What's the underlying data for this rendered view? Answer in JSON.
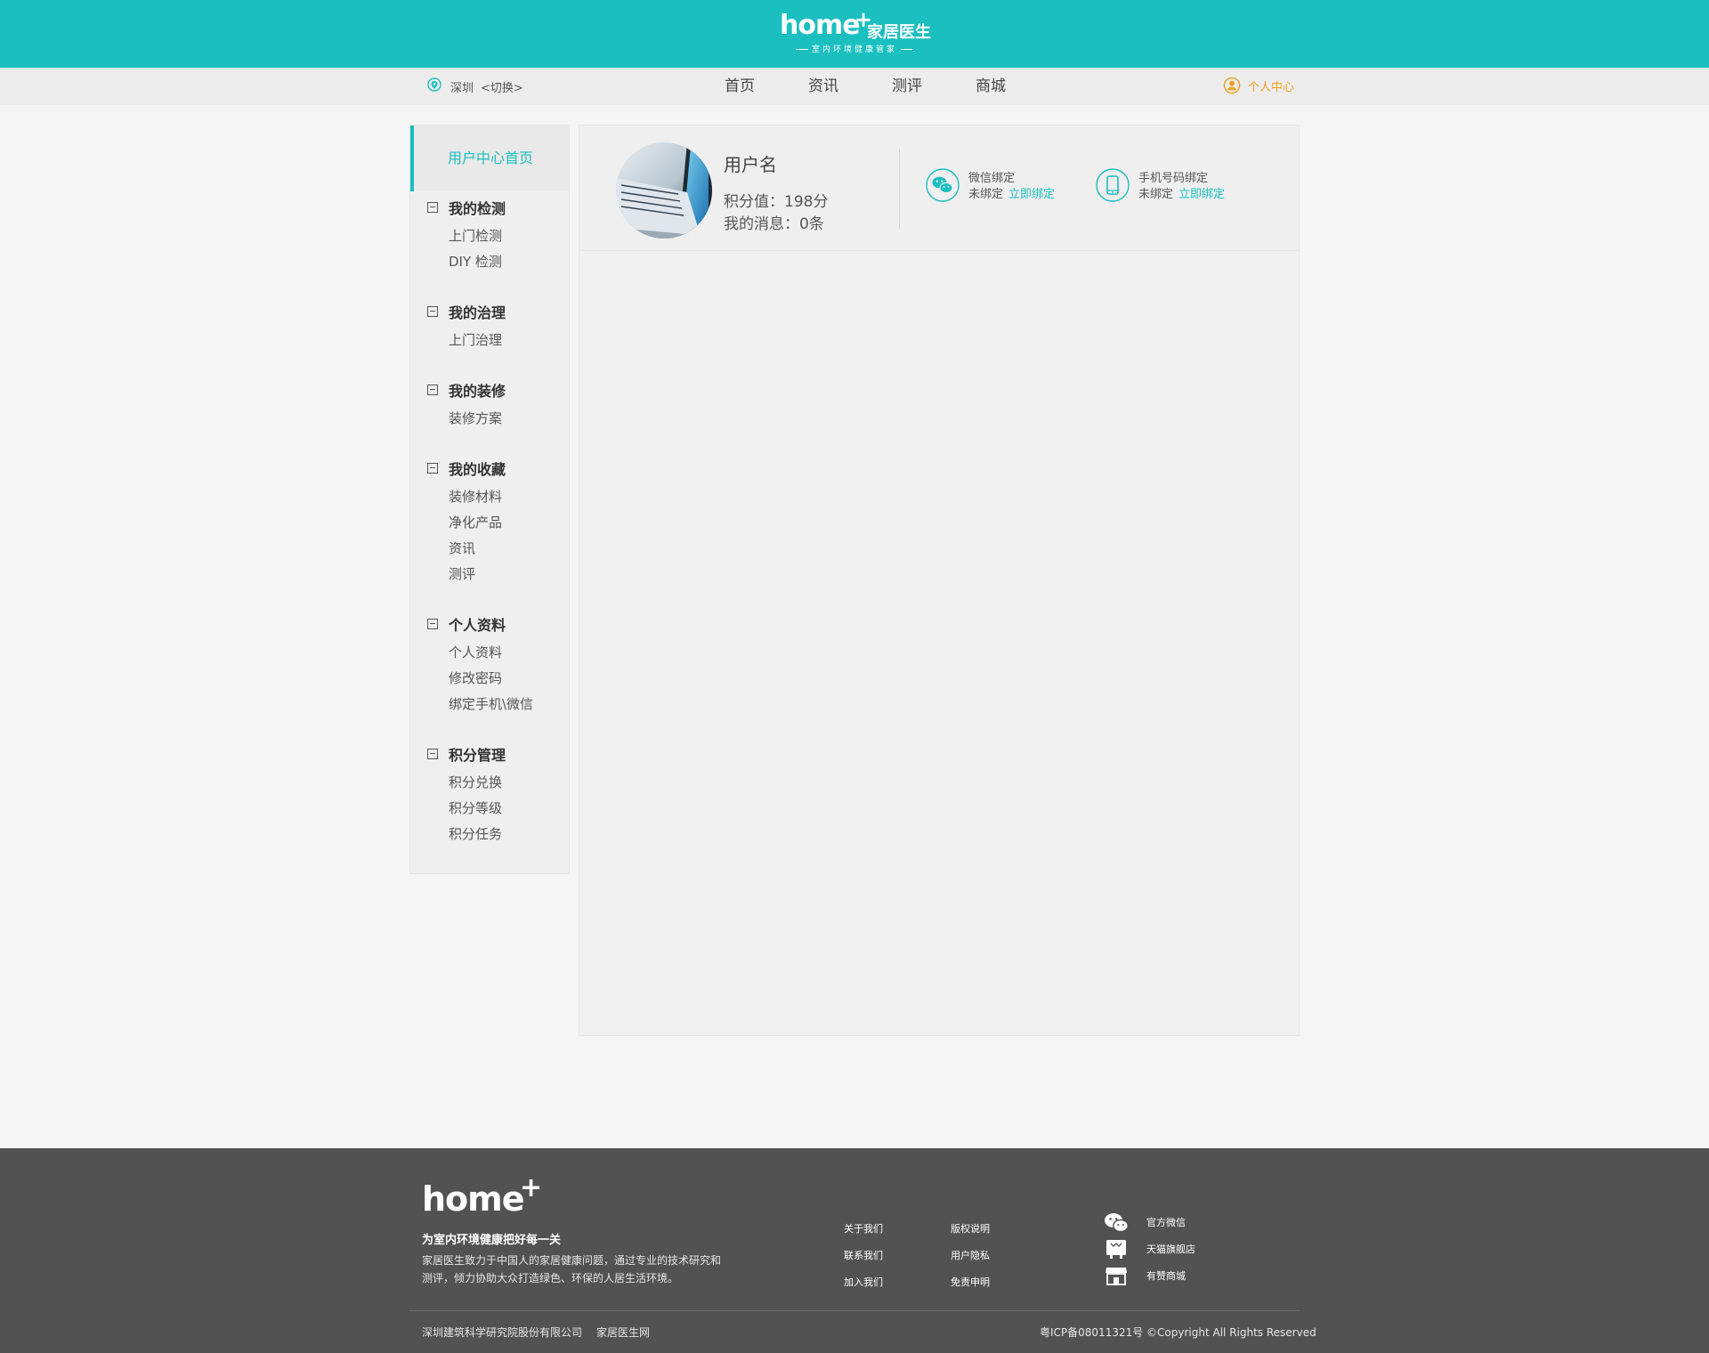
{
  "header": {
    "logo_main": "home",
    "logo_plus": "+",
    "logo_cn": "家居医生",
    "logo_sub": "室内环境健康管家"
  },
  "navbar": {
    "city": "深圳",
    "switch_label": "<切换>",
    "nav_items": [
      "首页",
      "资讯",
      "测评",
      "商城"
    ],
    "user_center": "个人中心"
  },
  "sidebar": {
    "home_label": "用户中心首页",
    "groups": [
      {
        "title": "我的检测",
        "items": [
          "上门检测",
          "DIY 检测"
        ]
      },
      {
        "title": "我的治理",
        "items": [
          "上门治理"
        ]
      },
      {
        "title": "我的装修",
        "items": [
          "装修方案"
        ]
      },
      {
        "title": "我的收藏",
        "items": [
          "装修材料",
          "净化产品",
          "资讯",
          "测评"
        ]
      },
      {
        "title": "个人资料",
        "items": [
          "个人资料",
          "修改密码",
          "绑定手机\\微信"
        ]
      },
      {
        "title": "积分管理",
        "items": [
          "积分兑换",
          "积分等级",
          "积分任务"
        ]
      }
    ]
  },
  "profile": {
    "username": "用户名",
    "points": "积分值：198分",
    "messages": "我的消息：0条",
    "wechat_title": "微信绑定",
    "wechat_status": "未绑定",
    "wechat_link": "立即绑定",
    "phone_title": "手机号码绑定",
    "phone_status": "未绑定",
    "phone_link": "立即绑定"
  },
  "footer": {
    "logo": "home",
    "logo_plus": "+",
    "slogan": "为室内环境健康把好每一关",
    "description": "家居医生致力于中国人的家居健康问题，通过专业的技术研究和测评，倾力协助大众打造绿色、环保的人居生活环境。",
    "links_col1": [
      "关于我们",
      "联系我们",
      "加入我们"
    ],
    "links_col2": [
      "版权说明",
      "用户隐私",
      "免责申明"
    ],
    "social": [
      "官方微信",
      "天猫旗舰店",
      "有赞商城"
    ],
    "company": "深圳建筑科学研究院股份有限公司",
    "site_name": "家居医生网",
    "copyright": "粤ICP备08011321号 ©Copyright All Rights Reserved"
  },
  "colors": {
    "brand": "#1bbfbf",
    "accent_orange": "#f0a020",
    "footer_bg": "#525252"
  },
  "icons": {
    "location": "location-pin-icon",
    "user": "user-circle-icon",
    "wechat": "wechat-icon",
    "phone": "mobile-phone-icon",
    "collapse": "minus-square-icon",
    "store": "store-icon",
    "tmall": "tmall-icon"
  }
}
